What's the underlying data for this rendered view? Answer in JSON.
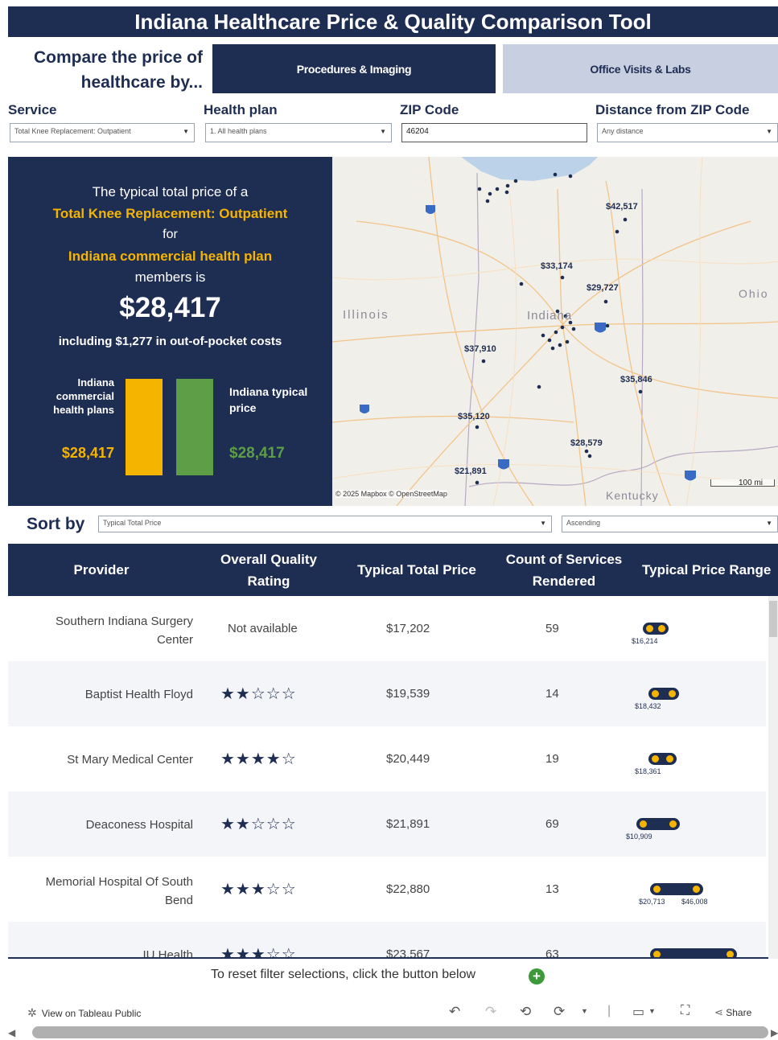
{
  "header": {
    "title": "Indiana Healthcare Price & Quality Comparison Tool"
  },
  "compare": {
    "line1": "Compare the price of",
    "line2": "healthcare by..."
  },
  "tabs": [
    {
      "label": "Procedures & Imaging",
      "active": true
    },
    {
      "label": "Office Visits & Labs",
      "active": false
    }
  ],
  "filters": {
    "service": {
      "label": "Service",
      "value": "Total Knee Replacement: Outpatient"
    },
    "health_plan": {
      "label": "Health plan",
      "value": "1. All health plans"
    },
    "zip": {
      "label": "ZIP Code",
      "value": "46204"
    },
    "distance": {
      "label": "Distance from ZIP Code",
      "value": "Any distance"
    }
  },
  "summary": {
    "line1": "The typical total price of a",
    "service": "Total Knee Replacement: Outpatient",
    "for": "for",
    "plan": "Indiana commercial health plan",
    "members": "members is",
    "price": "$28,417",
    "oop": "including $1,277 in out-of-pocket costs",
    "bar_left_label": [
      "Indiana",
      "commercial",
      "health plans"
    ],
    "bar_left_value": "$28,417",
    "bar_right_label": [
      "Indiana typical",
      "price"
    ],
    "bar_right_value": "$28,417",
    "bars": [
      28417,
      28417
    ]
  },
  "map": {
    "labels": {
      "illinois": "Illinois",
      "indiana": "Indiana",
      "ohio": "Ohio",
      "kentucky": "Kentucky"
    },
    "prices": [
      "$42,517",
      "$33,174",
      "$29,727",
      "$37,910",
      "$35,846",
      "$35,120",
      "$28,579",
      "$21,891"
    ],
    "attribution": "© 2025 Mapbox  © OpenStreetMap",
    "scale": "100 mi",
    "shields": [
      "65",
      "70",
      "74",
      "74",
      "65",
      "64",
      "65"
    ]
  },
  "sort": {
    "label": "Sort by",
    "field": "Typical Total Price",
    "order": "Ascending"
  },
  "table": {
    "headers": {
      "provider": "Provider",
      "quality": [
        "Overall Quality",
        "Rating"
      ],
      "price": "Typical Total Price",
      "count": [
        "Count of Services",
        "Rendered"
      ],
      "range": "Typical Price Range"
    },
    "rows": [
      {
        "provider": [
          "Southern Indiana Surgery",
          "Center"
        ],
        "rating_text": "Not available",
        "stars": null,
        "price": "$17,202",
        "count": "59",
        "range_low": "$16,214",
        "range_high": ""
      },
      {
        "provider": [
          "Baptist Health Floyd"
        ],
        "rating_text": "",
        "stars": 2,
        "price": "$19,539",
        "count": "14",
        "range_low": "$18,432",
        "range_high": ""
      },
      {
        "provider": [
          "St Mary Medical Center"
        ],
        "rating_text": "",
        "stars": 4,
        "price": "$20,449",
        "count": "19",
        "range_low": "$18,361",
        "range_high": ""
      },
      {
        "provider": [
          "Deaconess Hospital"
        ],
        "rating_text": "",
        "stars": 2,
        "price": "$21,891",
        "count": "69",
        "range_low": "$10,909",
        "range_high": ""
      },
      {
        "provider": [
          "Memorial Hospital Of South",
          "Bend"
        ],
        "rating_text": "",
        "stars": 3,
        "price": "$22,880",
        "count": "13",
        "range_low": "$20,713",
        "range_high": "$46,008"
      },
      {
        "provider": [
          "IU Health"
        ],
        "rating_text": "",
        "stars": 3,
        "price": "$23,567",
        "count": "63",
        "range_low": "",
        "range_high": ""
      }
    ]
  },
  "reset": {
    "text": "To reset filter selections, click the button below"
  },
  "footer": {
    "tableau": "View on Tableau Public",
    "share": "Share"
  }
}
